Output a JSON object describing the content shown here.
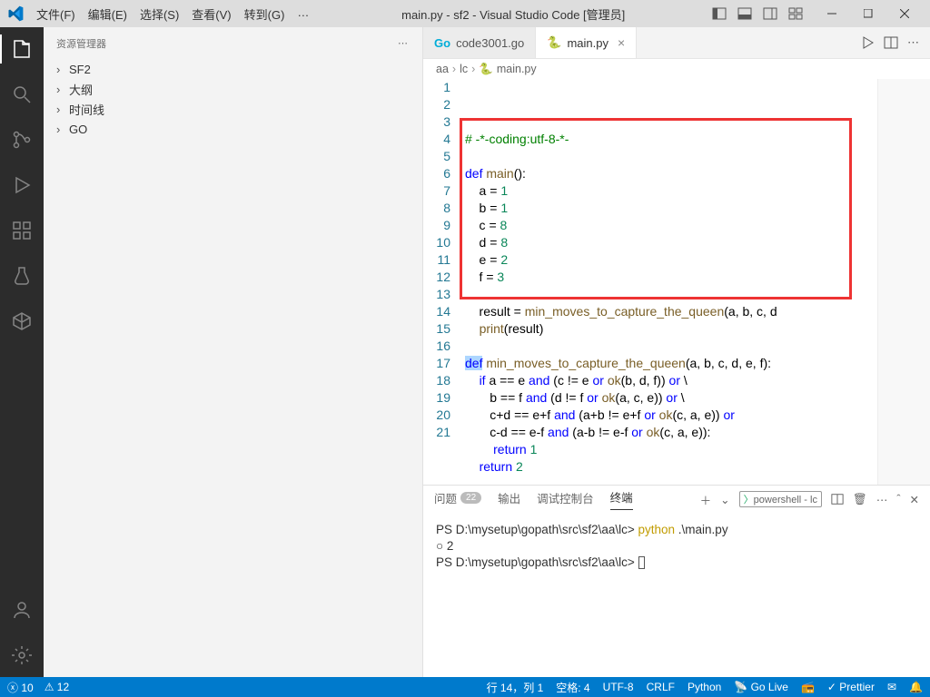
{
  "title": "main.py - sf2 - Visual Studio Code [管理员]",
  "menus": [
    "文件(F)",
    "编辑(E)",
    "选择(S)",
    "查看(V)",
    "转到(G)",
    "…"
  ],
  "sidebar": {
    "title": "资源管理器",
    "items": [
      "SF2",
      "大纲",
      "时间线",
      "GO"
    ]
  },
  "tabs": [
    {
      "icon": "go",
      "label": "code3001.go",
      "active": false
    },
    {
      "icon": "py",
      "label": "main.py",
      "active": true
    }
  ],
  "breadcrumb": [
    "aa",
    "lc",
    "main.py"
  ],
  "code_lines": [
    {
      "n": 1,
      "html": "<span class='cm'># -*-coding:utf-8-*-</span>"
    },
    {
      "n": 2,
      "html": ""
    },
    {
      "n": 3,
      "html": "<span class='kw'>def</span> <span class='fn'>main</span>():"
    },
    {
      "n": 4,
      "html": "    a = <span class='num'>1</span>"
    },
    {
      "n": 5,
      "html": "    b = <span class='num'>1</span>"
    },
    {
      "n": 6,
      "html": "    c = <span class='num'>8</span>"
    },
    {
      "n": 7,
      "html": "    d = <span class='num'>8</span>"
    },
    {
      "n": 8,
      "html": "    e = <span class='num'>2</span>"
    },
    {
      "n": 9,
      "html": "    f = <span class='num'>3</span>"
    },
    {
      "n": 10,
      "html": ""
    },
    {
      "n": 11,
      "html": "    result = <span class='fn'>min_moves_to_capture_the_queen</span>(a, b, c, d"
    },
    {
      "n": 12,
      "html": "    <span class='fn'>print</span>(result)"
    },
    {
      "n": 13,
      "html": ""
    },
    {
      "n": 14,
      "html": "<span class='kw' style='background:#add6ff'>def</span> <span class='fn'>min_moves_to_capture_the_queen</span>(a, b, c, d, e, f):"
    },
    {
      "n": 15,
      "html": "    <span class='kw'>if</span> a == e <span class='kw'>and</span> (c != e <span class='kw'>or</span> <span class='fn'>ok</span>(b, d, f)) <span class='kw'>or</span> \\"
    },
    {
      "n": 16,
      "html": "       b == f <span class='kw'>and</span> (d != f <span class='kw'>or</span> <span class='fn'>ok</span>(a, c, e)) <span class='kw'>or</span> \\"
    },
    {
      "n": 17,
      "html": "       c+d == e+f <span class='kw'>and</span> (a+b != e+f <span class='kw'>or</span> <span class='fn'>ok</span>(c, a, e)) <span class='kw'>or</span>"
    },
    {
      "n": 18,
      "html": "       c-d == e-f <span class='kw'>and</span> (a-b != e-f <span class='kw'>or</span> <span class='fn'>ok</span>(c, a, e)):"
    },
    {
      "n": 19,
      "html": "        <span class='kw'>return</span> <span class='num'>1</span>"
    },
    {
      "n": 20,
      "html": "    <span class='kw'>return</span> <span class='num'>2</span>"
    },
    {
      "n": 21,
      "html": ""
    }
  ],
  "panel": {
    "tabs": [
      {
        "label": "问题",
        "badge": "22"
      },
      {
        "label": "输出"
      },
      {
        "label": "调试控制台"
      },
      {
        "label": "终端",
        "active": true
      }
    ],
    "shell_label": "powershell - lc",
    "lines": [
      {
        "html": "<span class='prompt-path'>PS D:\\mysetup\\gopath\\src\\sf2\\aa\\lc&gt;</span> <span class='cmd-yellow'>python</span> .\\main.py"
      },
      {
        "html": "2",
        "prefix": "○ "
      },
      {
        "html": "<span class='prompt-path'>PS D:\\mysetup\\gopath\\src\\sf2\\aa\\lc&gt;</span> <span class='cursor'></span>"
      }
    ]
  },
  "status": {
    "left_err": "10",
    "left_warn": "12",
    "pos": "行 14，列 1",
    "spaces": "空格: 4",
    "enc": "UTF-8",
    "eol": "CRLF",
    "lang": "Python",
    "golive": "Go Live",
    "prettier": "Prettier"
  }
}
